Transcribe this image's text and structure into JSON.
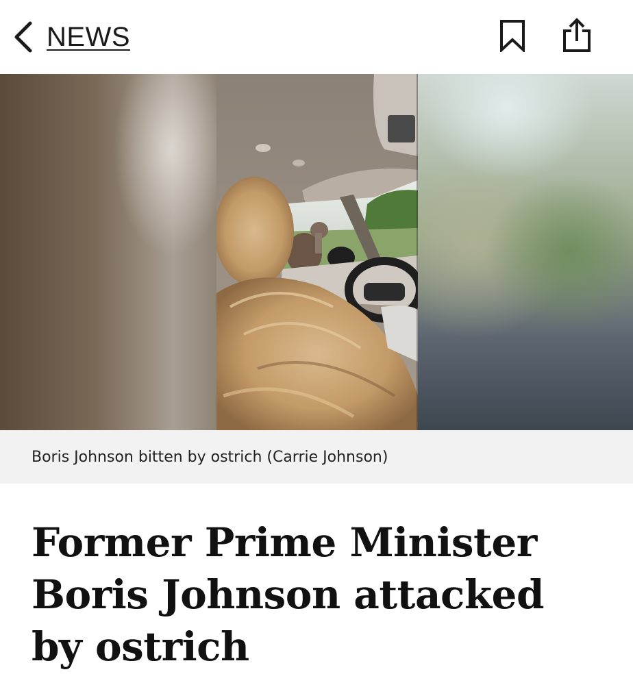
{
  "nav": {
    "back_label": "NEWS",
    "bookmark_icon": "bookmark-icon",
    "share_icon": "share-icon"
  },
  "media": {
    "caption": "Boris Johnson bitten by ostrich (Carrie Johnson)"
  },
  "article": {
    "headline": "Former Prime Minister Boris Johnson attacked by ostrich"
  },
  "colors": {
    "background": "#ffffff",
    "caption_background": "#f2f2f2",
    "text": "#111111"
  }
}
